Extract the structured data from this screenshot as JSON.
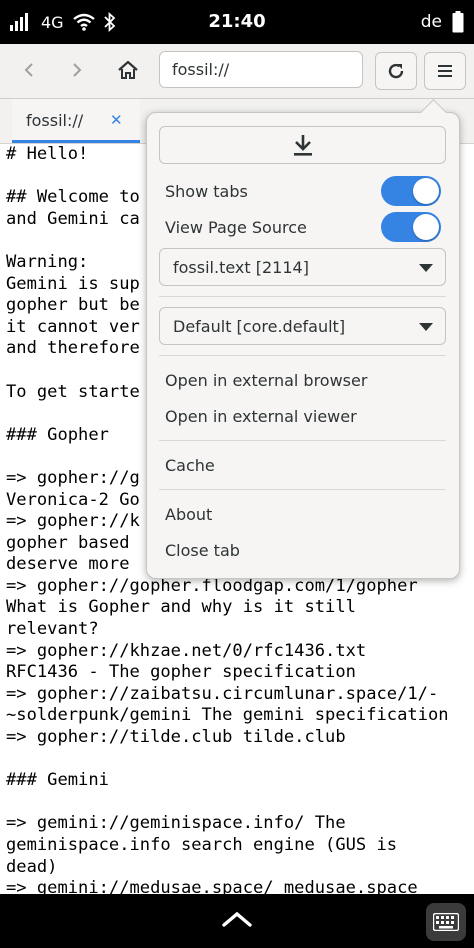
{
  "status_bar": {
    "network": "4G",
    "time": "21:40",
    "locale": "de"
  },
  "toolbar": {
    "url": "fossil://",
    "icons": [
      "back-icon",
      "forward-icon",
      "home-icon",
      "reload-icon",
      "hamburger-menu-icon"
    ]
  },
  "tab": {
    "label": "fossil://",
    "close": "✕"
  },
  "content_lines": [
    "# Hello!",
    "",
    "## Welcome to",
    "and Gemini ca",
    "",
    "Warning:",
    "Gemini is sup",
    "gopher but be",
    "it cannot ver",
    "and therefore",
    "",
    "To get starte",
    "",
    "### Gopher",
    "",
    "=> gopher://g",
    "Veronica-2 Go",
    "=> gopher://k",
    "gopher based",
    "deserve more",
    "=> gopher://gopher.floodgap.com/1/gopher",
    "What is Gopher and why is it still",
    "relevant?",
    "=> gopher://khzae.net/0/rfc1436.txt",
    "RFC1436 - The gopher specification",
    "=> gopher://zaibatsu.circumlunar.space/1/-",
    "~solderpunk/gemini The gemini specification",
    "=> gopher://tilde.club tilde.club",
    "",
    "### Gemini",
    "",
    "=> gemini://geminispace.info/ The",
    "geminispace.info search engine (GUS is",
    "dead)",
    "=> gemini://medusae.space/ medusae.space"
  ],
  "menu": {
    "download_icon": "download-icon",
    "show_tabs": {
      "label": "Show tabs",
      "on": true
    },
    "view_source": {
      "label": "View Page Source",
      "on": true
    },
    "source_select": "fossil.text [2114]",
    "style_select": "Default [core.default]",
    "open_external_browser": "Open in external browser",
    "open_external_viewer": "Open in external viewer",
    "cache": "Cache",
    "about": "About",
    "close_tab": "Close tab"
  },
  "colors": {
    "accent": "#3584e4",
    "menu_bg": "#f6f5f4",
    "toolbar_bg": "#f2f1f0"
  }
}
